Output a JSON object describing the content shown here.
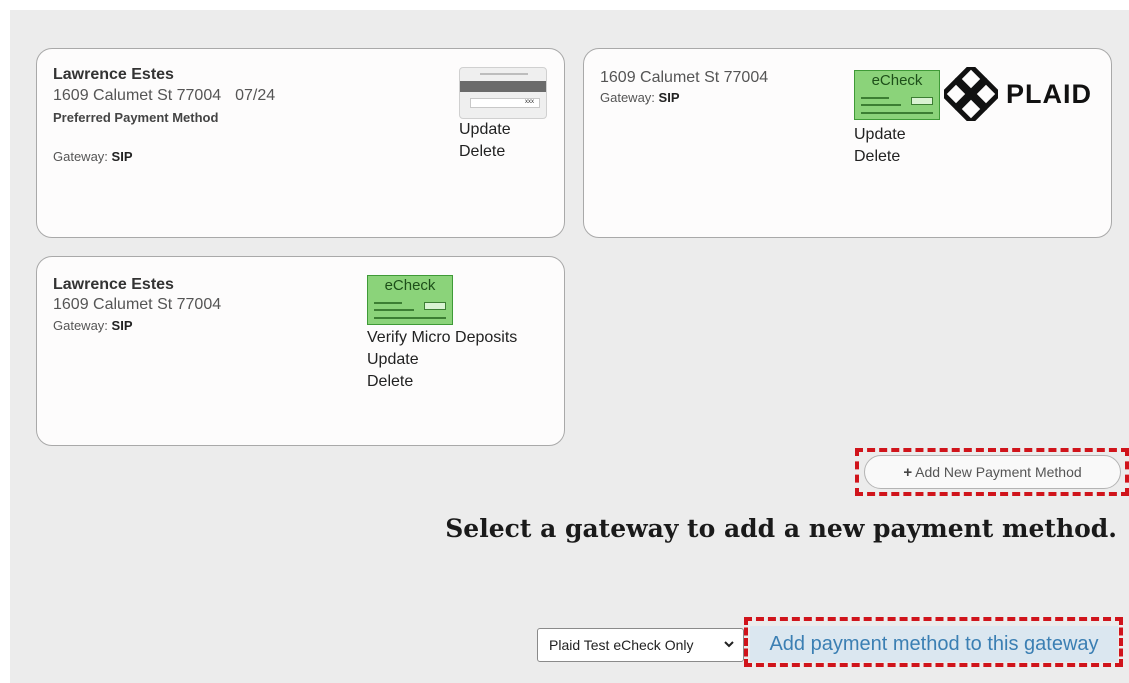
{
  "cards": [
    {
      "name": "Lawrence Estes",
      "address": "1609 Calumet St 77004",
      "expiry": "07/24",
      "preferred": "Preferred Payment Method",
      "gateway_label": "Gateway:",
      "gateway": "SIP",
      "icon": "credit-card-icon",
      "cvv_text": "xxx",
      "actions": [
        "Update",
        "Delete"
      ]
    },
    {
      "address": "1609 Calumet St 77004",
      "gateway_label": "Gateway:",
      "gateway": "SIP",
      "icon": "echeck-icon",
      "icon_label": "eCheck",
      "logo_text": "PLAID",
      "actions": [
        "Update",
        "Delete"
      ]
    },
    {
      "name": "Lawrence Estes",
      "address": "1609 Calumet St 77004",
      "gateway_label": "Gateway:",
      "gateway": "SIP",
      "icon": "echeck-icon",
      "icon_label": "eCheck",
      "actions": [
        "Verify Micro Deposits",
        "Update",
        "Delete"
      ]
    }
  ],
  "add_new_button": "Add New Payment Method",
  "headline": "Select a gateway to add a new payment method.",
  "gateway_select": {
    "selected": "Plaid Test eCheck Only"
  },
  "add_to_gateway_link": "Add payment method to this gateway",
  "colors": {
    "background": "#ececec",
    "card_bg": "#fdfcfc",
    "highlight_dash": "#d0141b",
    "link": "#3b7fb3",
    "link_bg": "#dbe7f0",
    "echeck_green": "#8bd37a"
  }
}
